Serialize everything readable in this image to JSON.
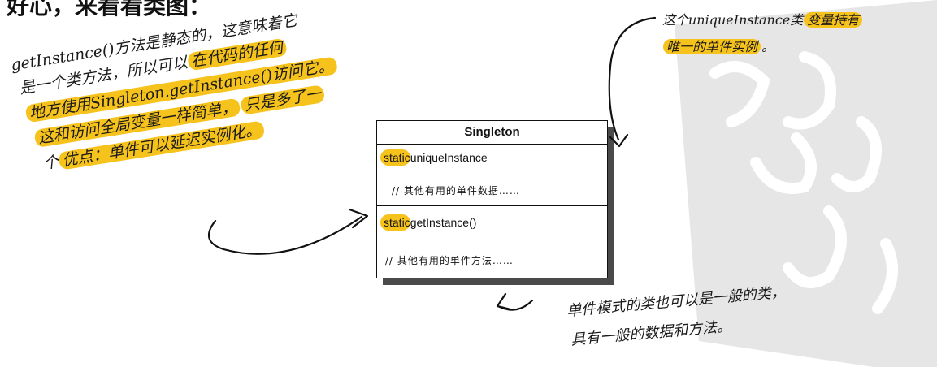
{
  "page": {
    "title_fragment": "好心，来看看类图："
  },
  "left_note": {
    "line1": "getInstance()方法是静态的，这意味着它",
    "line2_plain": "是一个类方法，所以可以",
    "line2_hl": "在代码的任何",
    "line3_hl": "地方使用Singleton.getInstance()访问它。",
    "line4_hl_a": "这和访问全局变量一样简单，",
    "line4_hl_b": "只是多了一",
    "line5_plain": "个",
    "line5_hl": "优点：单件可以延迟实例化。"
  },
  "uml": {
    "class_name": "Singleton",
    "attribute_keyword": "static",
    "attribute_name": "uniqueInstance",
    "attributes_comment": "//  其他有用的单件数据……",
    "operation_keyword": "static",
    "operation_name": "getInstance()",
    "operations_comment": "//  其他有用的单件方法……"
  },
  "top_right_note": {
    "line1_plain": "这个uniqueInstance类",
    "line1_hl": "变量持有",
    "line2_hl": "唯一的单件实例",
    "line2_plain": "。"
  },
  "bottom_note": {
    "line1": "单件模式的类也可以是一般的类，",
    "line2": "具有一般的数据和方法。"
  },
  "colors": {
    "highlight": "#f6c21c",
    "ink": "#111111",
    "shadow": "#4a4a4a",
    "watermark": "#e6e6e6"
  }
}
